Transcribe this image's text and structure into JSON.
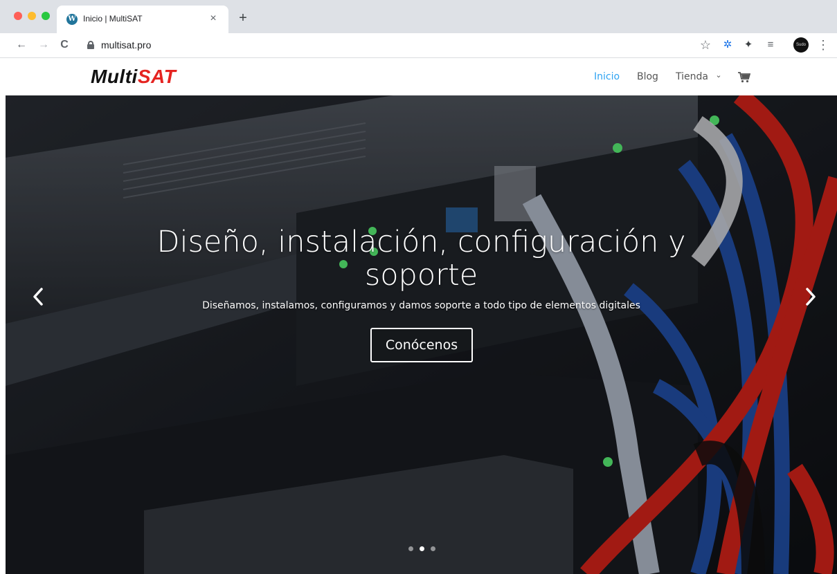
{
  "browser": {
    "tab_title": "Inicio | MultiSAT",
    "tab_favicon": "W",
    "tab_close": "×",
    "new_tab": "+",
    "url": "multisat.pro",
    "nav": {
      "back": "←",
      "forward": "→",
      "reload": "C"
    },
    "toolbar_icons": {
      "bookmark": "☆",
      "extension1": "✲",
      "puzzle": "✦",
      "media": "≡",
      "menu": "⋮"
    },
    "profile_label": "Sudo"
  },
  "site": {
    "logo_part1": "Multi",
    "logo_part2": "SAT",
    "menu": [
      {
        "label": "Inicio",
        "active": true
      },
      {
        "label": "Blog",
        "active": false
      },
      {
        "label": "Tienda",
        "active": false
      }
    ],
    "menu_chevron": "⌄"
  },
  "hero": {
    "title_line1": "Diseño, instalación, configuración y",
    "title_line2": "soporte",
    "subtitle": "Diseñamos, instalamos, configuramos y damos soporte a todo tipo de elementos digitales",
    "button_label": "Conócenos",
    "slides": 3,
    "active_slide": 2
  },
  "colors": {
    "accent": "#2ea3f2",
    "logo_red": "#e52421",
    "logo_black": "#111111"
  }
}
